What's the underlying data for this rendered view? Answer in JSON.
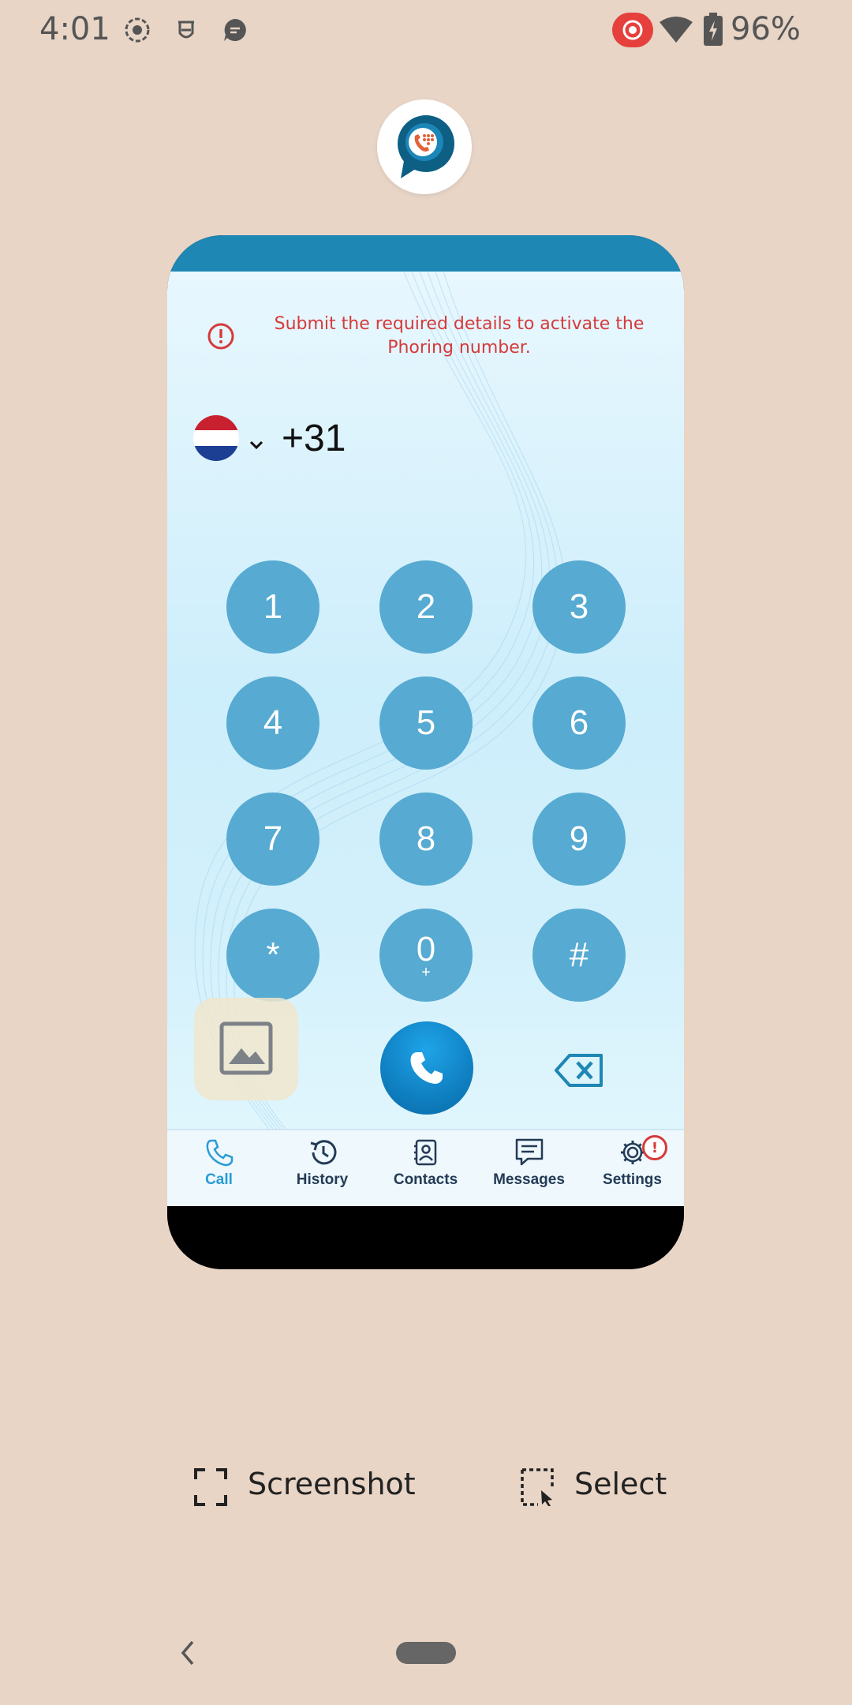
{
  "status_bar": {
    "time": "4:01",
    "battery_percent": "96%",
    "icons": [
      "screen-record-icon",
      "face-icon",
      "chat-bubble-icon",
      "cast-record-icon",
      "wifi-icon",
      "battery-charging-icon"
    ]
  },
  "app_logo": {
    "icon": "phoring-logo-icon"
  },
  "preview": {
    "alert": {
      "icon": "alert-circle-icon",
      "message": "Submit the required details to activate the Phoring number."
    },
    "country": {
      "flag": "netherlands-flag-icon",
      "dial_code": "+31"
    },
    "keypad": [
      {
        "label": "1",
        "sub": ""
      },
      {
        "label": "2",
        "sub": ""
      },
      {
        "label": "3",
        "sub": ""
      },
      {
        "label": "4",
        "sub": ""
      },
      {
        "label": "5",
        "sub": ""
      },
      {
        "label": "6",
        "sub": ""
      },
      {
        "label": "7",
        "sub": ""
      },
      {
        "label": "8",
        "sub": ""
      },
      {
        "label": "9",
        "sub": ""
      },
      {
        "label": "*",
        "sub": ""
      },
      {
        "label": "0",
        "sub": "+"
      },
      {
        "label": "#",
        "sub": ""
      }
    ],
    "tabs": [
      {
        "label": "Call",
        "icon": "phone-icon",
        "active": true
      },
      {
        "label": "History",
        "icon": "history-icon",
        "active": false
      },
      {
        "label": "Contacts",
        "icon": "contacts-icon",
        "active": false
      },
      {
        "label": "Messages",
        "icon": "messages-icon",
        "active": false
      },
      {
        "label": "Settings",
        "icon": "settings-icon",
        "active": false,
        "badge": "!"
      }
    ],
    "colors": {
      "header": "#1e87b4",
      "key": "#57aad1",
      "alert": "#d63a3a",
      "active_tab": "#2a9bd6"
    }
  },
  "actions": {
    "screenshot_label": "Screenshot",
    "select_label": "Select"
  },
  "background": "#e8d5c6"
}
